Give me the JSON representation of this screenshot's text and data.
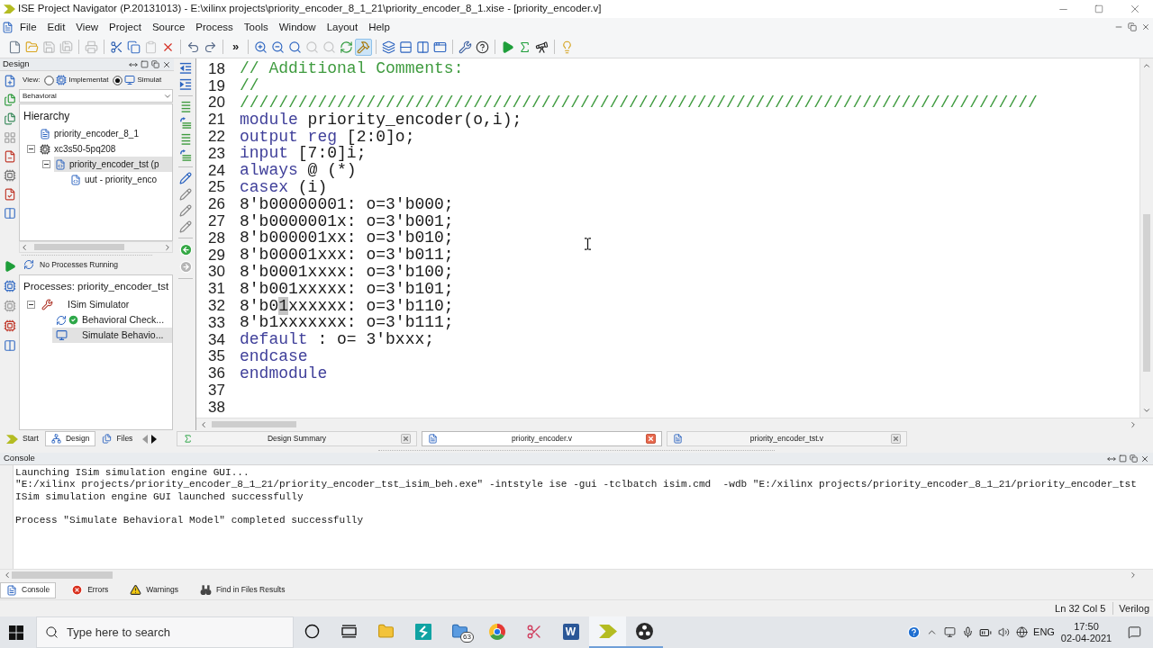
{
  "title_bar": {
    "title": "ISE Project Navigator (P.20131013) - E:\\xilinx projects\\priority_encoder_8_1_21\\priority_encoder_8_1.xise - [priority_encoder.v]"
  },
  "menu": [
    "File",
    "Edit",
    "View",
    "Project",
    "Source",
    "Process",
    "Tools",
    "Window",
    "Layout",
    "Help"
  ],
  "toolbar": [
    [
      {
        "kind": "new",
        "pressed": false,
        "disabled": false
      },
      {
        "kind": "open",
        "pressed": false,
        "disabled": false
      },
      {
        "kind": "save",
        "pressed": false,
        "disabled": true
      },
      {
        "kind": "saveall",
        "pressed": false,
        "disabled": true
      }
    ],
    [
      {
        "kind": "print",
        "pressed": false,
        "disabled": true
      }
    ],
    [
      {
        "kind": "cut",
        "pressed": false,
        "disabled": false
      },
      {
        "kind": "copy",
        "pressed": false,
        "disabled": false
      },
      {
        "kind": "paste",
        "pressed": false,
        "disabled": true
      },
      {
        "kind": "delete",
        "pressed": false,
        "disabled": false
      }
    ],
    [
      {
        "kind": "undo",
        "pressed": false,
        "disabled": false
      },
      {
        "kind": "redo",
        "pressed": false,
        "disabled": false
      }
    ],
    [
      {
        "kind": "more",
        "label": "»",
        "pressed": false,
        "disabled": false
      }
    ],
    [
      {
        "kind": "zoomin",
        "pressed": false,
        "disabled": false
      },
      {
        "kind": "zoomout",
        "pressed": false,
        "disabled": false
      },
      {
        "kind": "zoomfit",
        "pressed": false,
        "disabled": false
      },
      {
        "kind": "zoomfull",
        "pressed": false,
        "disabled": true
      },
      {
        "kind": "zoomsel",
        "pressed": false,
        "disabled": true
      },
      {
        "kind": "refresh",
        "pressed": false,
        "disabled": false
      },
      {
        "kind": "hammer",
        "pressed": true,
        "disabled": false
      }
    ],
    [
      {
        "kind": "cascade",
        "pressed": false,
        "disabled": false
      },
      {
        "kind": "tilerows",
        "pressed": false,
        "disabled": false
      },
      {
        "kind": "tilecols",
        "pressed": false,
        "disabled": false
      },
      {
        "kind": "float",
        "pressed": false,
        "disabled": false
      }
    ],
    [
      {
        "kind": "wrench",
        "pressed": false,
        "disabled": false
      },
      {
        "kind": "whatsthis",
        "pressed": false,
        "disabled": false
      }
    ],
    [
      {
        "kind": "run",
        "pressed": false,
        "disabled": false
      },
      {
        "kind": "sigma",
        "pressed": false,
        "disabled": false
      },
      {
        "kind": "telescope",
        "pressed": false,
        "disabled": false
      }
    ],
    [
      {
        "kind": "bulb",
        "pressed": false,
        "disabled": false
      }
    ]
  ],
  "design_panel": {
    "title": "Design",
    "view_label": "View:",
    "view_options": [
      {
        "kind": "implementation",
        "label": "Implementat",
        "selected": false
      },
      {
        "kind": "simulation",
        "label": "Simulat",
        "selected": true
      }
    ],
    "dropdown": "Behavioral",
    "tree_title": "Hierarchy",
    "tree": [
      {
        "kind": "project",
        "label": "priority_encoder_8_1",
        "selected": false
      },
      {
        "kind": "device",
        "label": "xc3s50-5pq208",
        "selected": false,
        "expanded": true,
        "children": [
          {
            "kind": "source",
            "label": "priority_encoder_tst (p",
            "selected": true,
            "expanded": true,
            "children": [
              {
                "kind": "source",
                "label": "uut - priority_enco",
                "selected": false
              }
            ]
          }
        ]
      }
    ]
  },
  "process_panel": {
    "status": "No Processes Running",
    "title": "Processes: priority_encoder_tst",
    "tree": [
      {
        "kind": "tool",
        "label": "ISim Simulator",
        "selected": false,
        "expanded": true,
        "children": [
          {
            "kind": "check",
            "label": "Behavioral Check...",
            "selected": false
          },
          {
            "kind": "simulate",
            "label": "Simulate Behavio...",
            "selected": true
          }
        ]
      }
    ]
  },
  "editor": {
    "lines": [
      {
        "number": "18",
        "segments": [
          {
            "kind": "comment",
            "text": "// Additional Comments:"
          }
        ]
      },
      {
        "number": "19",
        "segments": [
          {
            "kind": "comment",
            "text": "//"
          }
        ]
      },
      {
        "number": "20",
        "segments": [
          {
            "kind": "comment",
            "text": "//////////////////////////////////////////////////////////////////////////////////"
          }
        ]
      },
      {
        "number": "21",
        "segments": [
          {
            "kind": "keyword",
            "text": "module"
          },
          {
            "kind": "plain",
            "text": " priority_encoder(o,i);"
          }
        ]
      },
      {
        "number": "22",
        "segments": [
          {
            "kind": "keyword",
            "text": "output reg"
          },
          {
            "kind": "plain",
            "text": " [2:0]o;"
          }
        ]
      },
      {
        "number": "23",
        "segments": [
          {
            "kind": "keyword",
            "text": "input"
          },
          {
            "kind": "plain",
            "text": " [7:0]i;"
          }
        ]
      },
      {
        "number": "24",
        "segments": [
          {
            "kind": "keyword",
            "text": "always"
          },
          {
            "kind": "plain",
            "text": " @ (*)"
          }
        ]
      },
      {
        "number": "25",
        "segments": [
          {
            "kind": "keyword",
            "text": "casex"
          },
          {
            "kind": "plain",
            "text": " (i)"
          }
        ]
      },
      {
        "number": "26",
        "segments": [
          {
            "kind": "plain",
            "text": "8'b00000001: o=3'b000;"
          }
        ]
      },
      {
        "number": "27",
        "segments": [
          {
            "kind": "plain",
            "text": "8'b0000001x: o=3'b001;"
          }
        ]
      },
      {
        "number": "28",
        "segments": [
          {
            "kind": "plain",
            "text": "8'b000001xx: o=3'b010;"
          }
        ]
      },
      {
        "number": "29",
        "segments": [
          {
            "kind": "plain",
            "text": "8'b00001xxx: o=3'b011;"
          }
        ]
      },
      {
        "number": "30",
        "segments": [
          {
            "kind": "plain",
            "text": "8'b0001xxxx: o=3'b100;"
          }
        ]
      },
      {
        "number": "31",
        "segments": [
          {
            "kind": "plain",
            "text": "8'b001xxxxx: o=3'b101;"
          }
        ]
      },
      {
        "number": "32",
        "segments": [
          {
            "kind": "plain",
            "text": "8'b0"
          },
          {
            "kind": "caret",
            "text": "1"
          },
          {
            "kind": "plain",
            "text": "xxxxxx: o=3'b110;"
          }
        ]
      },
      {
        "number": "33",
        "segments": [
          {
            "kind": "plain",
            "text": "8'b1xxxxxxx: o=3'b111;"
          }
        ]
      },
      {
        "number": "34",
        "segments": [
          {
            "kind": "keyword",
            "text": "default"
          },
          {
            "kind": "plain",
            "text": " : o= 3'bxxx;"
          }
        ]
      },
      {
        "number": "35",
        "segments": [
          {
            "kind": "keyword",
            "text": "endcase"
          }
        ]
      },
      {
        "number": "36",
        "segments": [
          {
            "kind": "keyword",
            "text": "endmodule"
          }
        ]
      },
      {
        "number": "37"
      },
      {
        "number": "38"
      }
    ]
  },
  "panel_tabs": [
    {
      "kind": "start",
      "label": "Start",
      "selected": false
    },
    {
      "kind": "design",
      "label": "Design",
      "selected": true
    },
    {
      "kind": "files",
      "label": "Files",
      "selected": false
    }
  ],
  "document_tabs": [
    {
      "kind": "summary",
      "label": "Design Summary",
      "selected": false
    },
    {
      "kind": "source",
      "label": "priority_encoder.v",
      "selected": true
    },
    {
      "kind": "source",
      "label": "priority_encoder_tst.v",
      "selected": false
    }
  ],
  "console": {
    "title": "Console",
    "blocks": [
      [
        "Launching ISim simulation engine GUI...",
        "\"E:/xilinx projects/priority_encoder_8_1_21/priority_encoder_tst_isim_beh.exe\" -intstyle ise -gui -tclbatch isim.cmd  -wdb \"E:/xilinx projects/priority_encoder_8_1_21/priority_encoder_tst",
        "ISim simulation engine GUI launched successfully"
      ],
      [
        "Process \"Simulate Behavioral Model\" completed successfully"
      ]
    ]
  },
  "bottom_tabs": [
    {
      "kind": "console",
      "label": "Console",
      "selected": true
    },
    {
      "kind": "errors",
      "label": "Errors",
      "selected": false
    },
    {
      "kind": "warnings",
      "label": "Warnings",
      "selected": false
    },
    {
      "kind": "find",
      "label": "Find in Files Results",
      "selected": false
    }
  ],
  "status_bar": {
    "position": "Ln 32 Col 5",
    "language": "Verilog"
  },
  "taskbar": {
    "search": {
      "placeholder": "Type here to search"
    },
    "apps": [
      {
        "kind": "cortana",
        "running": false,
        "active": false
      },
      {
        "kind": "taskview",
        "running": false,
        "active": false
      },
      {
        "kind": "explorer",
        "running": false,
        "active": false
      },
      {
        "kind": "sway",
        "running": false,
        "active": false
      },
      {
        "kind": "folder",
        "badge": "63",
        "running": false,
        "active": false
      },
      {
        "kind": "browser",
        "running": false,
        "active": false
      },
      {
        "kind": "snip",
        "running": false,
        "active": false
      },
      {
        "kind": "word",
        "label": "W",
        "running": false,
        "active": false
      },
      {
        "kind": "ise",
        "running": true,
        "active": true
      },
      {
        "kind": "obs",
        "running": true,
        "active": false
      }
    ],
    "language": "ENG",
    "time": "17:50",
    "date": "02-04-2021"
  }
}
